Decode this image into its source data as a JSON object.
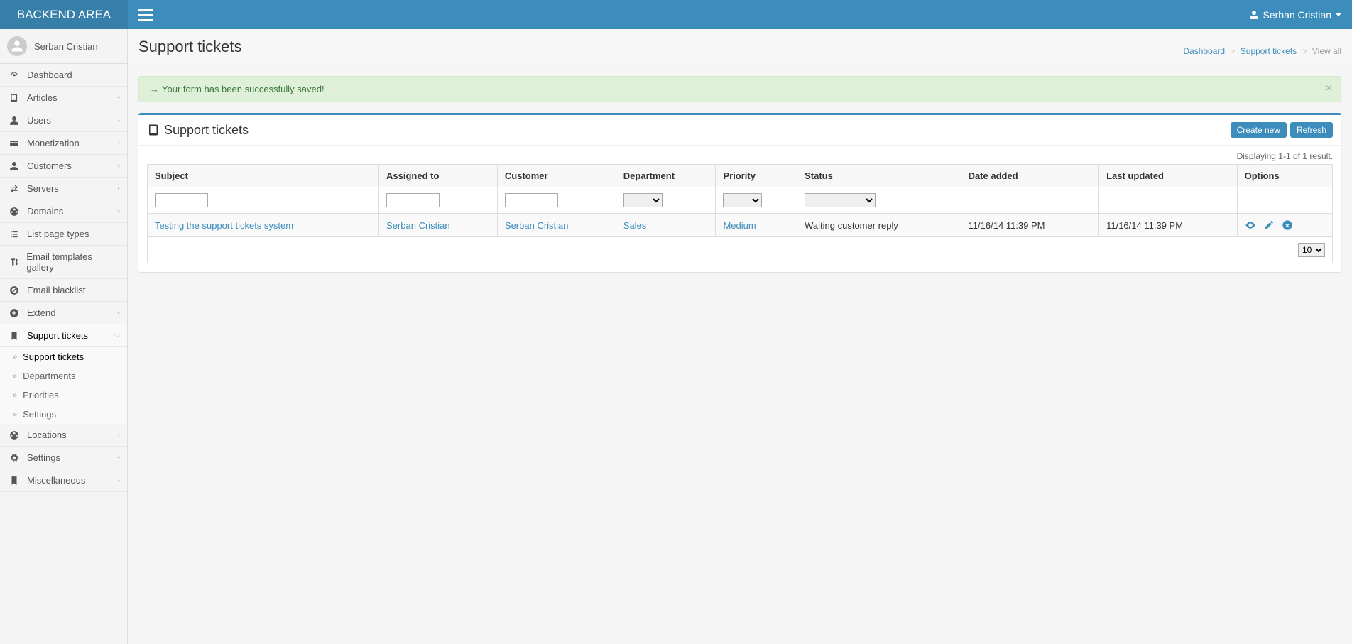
{
  "brand": "BACKEND AREA",
  "current_user": "Serban Cristian",
  "sidebar": {
    "user_name": "Serban Cristian",
    "items": [
      {
        "label": "Dashboard",
        "icon": "tachometer"
      },
      {
        "label": "Articles",
        "icon": "book",
        "expandable": true
      },
      {
        "label": "Users",
        "icon": "user",
        "expandable": true
      },
      {
        "label": "Monetization",
        "icon": "credit-card",
        "expandable": true
      },
      {
        "label": "Customers",
        "icon": "user",
        "expandable": true
      },
      {
        "label": "Servers",
        "icon": "transfer",
        "expandable": true
      },
      {
        "label": "Domains",
        "icon": "globe",
        "expandable": true
      },
      {
        "label": "List page types",
        "icon": "list"
      },
      {
        "label": "Email templates gallery",
        "icon": "text-height"
      },
      {
        "label": "Email blacklist",
        "icon": "ban"
      },
      {
        "label": "Extend",
        "icon": "plus-circle",
        "expandable": true
      },
      {
        "label": "Support tickets",
        "icon": "bookmark",
        "expandable": true,
        "active": true,
        "open": true,
        "children": [
          {
            "label": "Support tickets",
            "active": true
          },
          {
            "label": "Departments"
          },
          {
            "label": "Priorities"
          },
          {
            "label": "Settings"
          }
        ]
      },
      {
        "label": "Locations",
        "icon": "globe",
        "expandable": true
      },
      {
        "label": "Settings",
        "icon": "cog",
        "expandable": true
      },
      {
        "label": "Miscellaneous",
        "icon": "bookmark",
        "expandable": true
      }
    ]
  },
  "page": {
    "title": "Support tickets",
    "breadcrumb": {
      "dashboard": "Dashboard",
      "section": "Support tickets",
      "leaf": "View all"
    }
  },
  "alert": {
    "message": "Your form has been successfully saved!"
  },
  "panel": {
    "title": "Support tickets",
    "create_label": "Create new",
    "refresh_label": "Refresh",
    "result_info": "Displaying 1-1 of 1 result.",
    "columns": [
      "Subject",
      "Assigned to",
      "Customer",
      "Department",
      "Priority",
      "Status",
      "Date added",
      "Last updated",
      "Options"
    ],
    "rows": [
      {
        "subject": "Testing the support tickets system",
        "assigned_to": "Serban Cristian",
        "customer": "Serban Cristian",
        "department": "Sales",
        "priority": "Medium",
        "status": "Waiting customer reply",
        "date_added": "11/16/14 11:39 PM",
        "last_updated": "11/16/14 11:39 PM"
      }
    ],
    "page_size": "10"
  }
}
